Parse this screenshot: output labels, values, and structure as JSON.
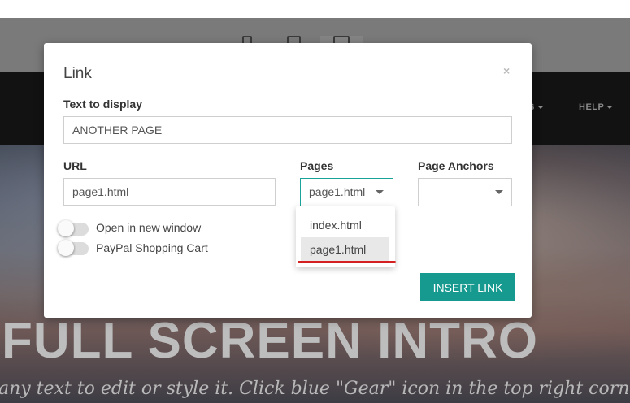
{
  "background": {
    "nav_items": [
      {
        "label": "S"
      },
      {
        "label": "HELP"
      }
    ],
    "hero_title": "FULL SCREEN INTRO",
    "hero_subtitle": "any text to edit or style it. Click blue \"Gear\" icon in the top right corner to"
  },
  "modal": {
    "title": "Link",
    "close_glyph": "×",
    "text_to_display_label": "Text to display",
    "text_to_display_value": "ANOTHER PAGE",
    "url_label": "URL",
    "url_value": "page1.html",
    "pages_label": "Pages",
    "pages_selected": "page1.html",
    "page_anchors_label": "Page Anchors",
    "page_anchors_selected": "",
    "toggles": [
      {
        "label": "Open in new window"
      },
      {
        "label": "PayPal Shopping Cart"
      }
    ],
    "pages_options": [
      "index.html",
      "page1.html"
    ],
    "insert_button_label": "INSERT LINK"
  },
  "colors": {
    "accent": "#16998f",
    "highlight": "#d42020"
  }
}
